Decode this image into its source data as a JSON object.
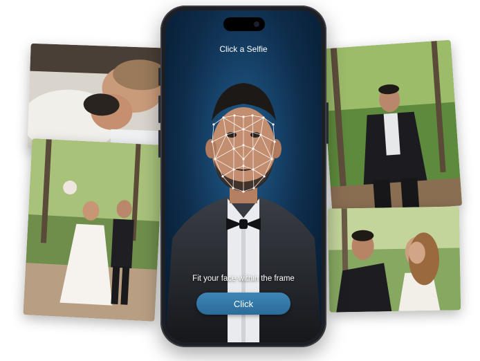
{
  "screen": {
    "title": "Click a Selfie",
    "hint": "Fit your face within the frame",
    "button_label": "Click"
  },
  "colors": {
    "screen_bg": "#0d2b49",
    "button": "#2f77a8",
    "mesh": "#ffffff"
  },
  "photos": [
    {
      "name": "couple-lying-photo",
      "subject": "couple lying down"
    },
    {
      "name": "couple-walking-forest-photo",
      "subject": "bride and groom walking in forest"
    },
    {
      "name": "groom-forest-photo",
      "subject": "groom standing in forest"
    },
    {
      "name": "couple-embrace-photo",
      "subject": "couple embracing"
    }
  ]
}
